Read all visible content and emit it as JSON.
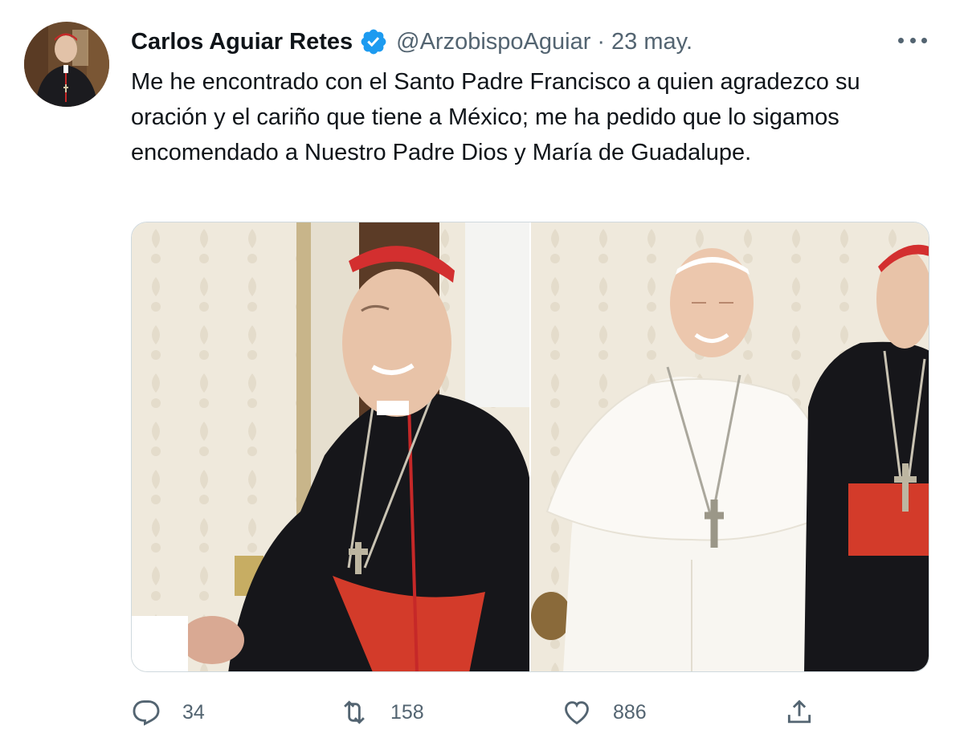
{
  "author": {
    "display_name": "Carlos Aguiar Retes",
    "handle": "@ArzobispoAguiar",
    "separator": "·",
    "date": "23 may."
  },
  "tweet": {
    "text": "Me he encontrado con el Santo Padre Francisco a quien agradezco su oración y el cariño que tiene a México; me ha pedido que lo sigamos encomendado a Nuestro Padre Dios y María de Guadalupe."
  },
  "actions": {
    "replies": "34",
    "retweets": "158",
    "likes": "886"
  },
  "icons": {
    "verified": "verified-badge-icon",
    "more": "more-options-icon",
    "reply": "reply-icon",
    "retweet": "retweet-icon",
    "like": "heart-icon",
    "share": "share-icon"
  },
  "colors": {
    "verified": "#1d9bf0",
    "secondary_text": "#536471",
    "primary_text": "#0f1419"
  }
}
